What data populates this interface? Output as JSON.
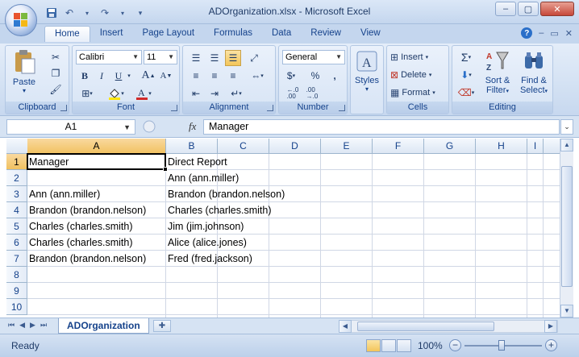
{
  "window": {
    "title": "ADOrganization.xlsx - Microsoft Excel",
    "minimize": "–",
    "maximize": "▢",
    "close": "✕"
  },
  "qat": {
    "save": "💾",
    "undo": "↶",
    "redo": "↷",
    "customize": "▾"
  },
  "tabs": [
    "Home",
    "Insert",
    "Page Layout",
    "Formulas",
    "Data",
    "Review",
    "View"
  ],
  "active_tab": "Home",
  "ribbon": {
    "groups": {
      "clipboard": "Clipboard",
      "font": "Font",
      "alignment": "Alignment",
      "number": "Number",
      "cells": "Cells",
      "editing": "Editing"
    },
    "paste_label": "Paste",
    "font_name": "Calibri",
    "font_size": "11",
    "number_format": "General",
    "styles_label": "Styles",
    "insert_label": "Insert",
    "delete_label": "Delete",
    "format_label": "Format",
    "sort_label": "Sort &",
    "filter_label": "Filter",
    "find_label": "Find &",
    "select_label": "Select",
    "bold": "B",
    "italic": "I",
    "underline": "U",
    "grow_font": "A",
    "shrink_font": "A",
    "currency": "$",
    "percent": "%",
    "comma": ",",
    "inc_decimal": "←.0\n.00",
    "dec_decimal": ".00\n→.0",
    "sum": "Σ",
    "accent_font_color": "#d12a2a",
    "accent_fill_color": "#ffe600"
  },
  "formula_bar": {
    "name_box": "A1",
    "fx": "fx",
    "formula": "Manager"
  },
  "columns": [
    "A",
    "B",
    "C",
    "D",
    "E",
    "F",
    "G",
    "H",
    "I"
  ],
  "rows": [
    "1",
    "2",
    "3",
    "4",
    "5",
    "6",
    "7",
    "8",
    "9",
    "10"
  ],
  "cells": {
    "A1": "Manager",
    "B1": "Direct Report",
    "A2": "",
    "B2": "Ann (ann.miller)",
    "A3": "Ann (ann.miller)",
    "B3": "Brandon (brandon.nelson)",
    "A4": "Brandon (brandon.nelson)",
    "B4": "Charles (charles.smith)",
    "A5": "Charles (charles.smith)",
    "B5": "Jim (jim.johnson)",
    "A6": "Charles (charles.smith)",
    "B6": "Alice (alice.jones)",
    "A7": "Brandon (brandon.nelson)",
    "B7": "Fred (fred.jackson)"
  },
  "sheet_tab": "ADOrganization",
  "status": {
    "text": "Ready",
    "zoom": "100%"
  }
}
